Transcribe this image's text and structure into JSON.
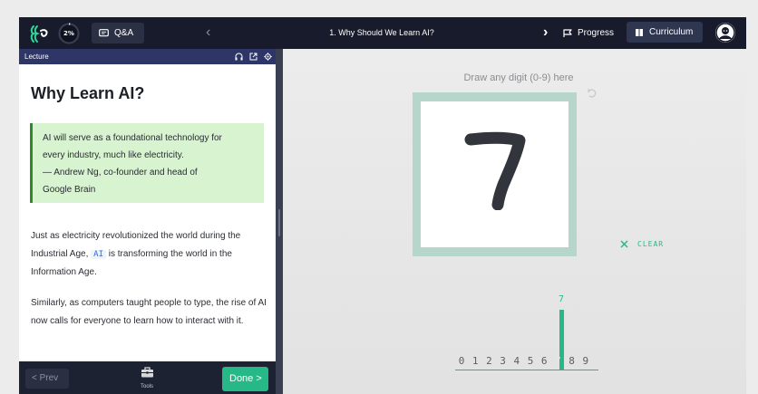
{
  "topbar": {
    "progress_percent": 2,
    "progress_label": "2%",
    "qa_label": "Q&A",
    "lesson_title": "1. Why Should We Learn AI?",
    "progress_button": "Progress",
    "curriculum_button": "Curriculum"
  },
  "lecture": {
    "header_label": "Lecture",
    "title": "Why Learn AI?",
    "quote_line1": "AI will serve as a foundational technology for",
    "quote_line2": "every industry, much like electricity.",
    "quote_line3": "— Andrew Ng, co-founder and head of",
    "quote_line4": "Google Brain",
    "para1_before": "Just as electricity revolutionized the world during the Industrial Age,",
    "para1_code": "AI",
    "para1_after": "is transforming the world in the Information Age.",
    "para2": "Similarly, as computers taught people to type, the rise of AI now calls for everyone to learn how to interact with it."
  },
  "footer": {
    "prev_label": "< Prev",
    "tools_label": "Tools",
    "done_label": "Done >"
  },
  "demo": {
    "instruction": "Draw any digit (0-9) here",
    "clear_label": "CLEAR",
    "predicted_label": "7",
    "digits": [
      "0",
      "1",
      "2",
      "3",
      "4",
      "5",
      "6",
      "7",
      "8",
      "9"
    ],
    "predicted_index": 7,
    "predicted_confidence": 1.0
  },
  "colors": {
    "accent": "#27b887",
    "topbar": "#181b2c",
    "lecture_header": "#2e3567",
    "quote_bg": "#d7f3cf"
  }
}
